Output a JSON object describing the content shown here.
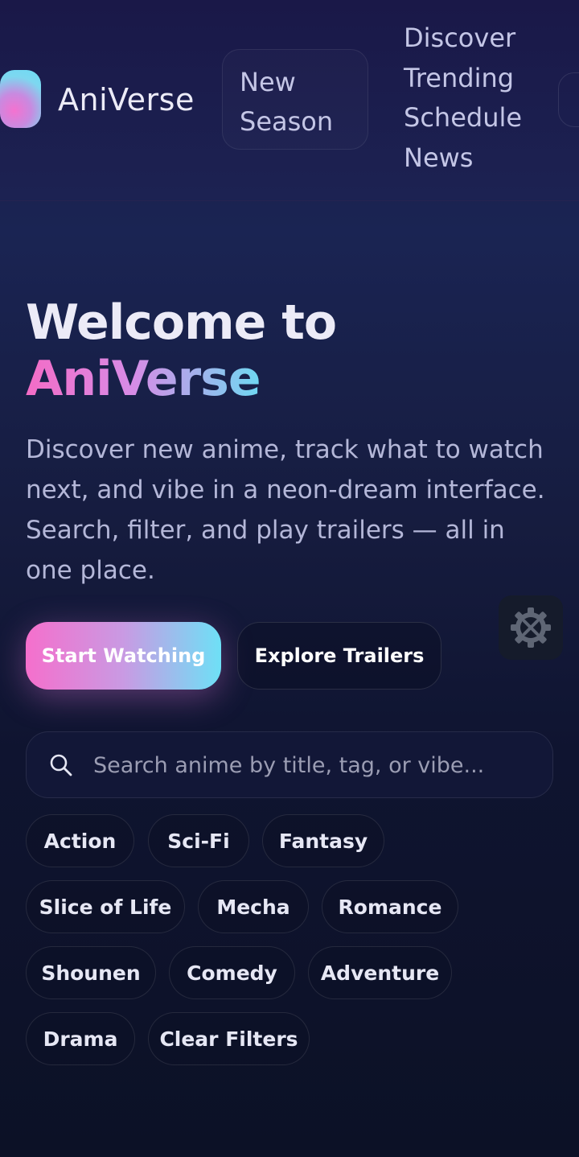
{
  "brand": {
    "name": "AniVerse"
  },
  "nav": {
    "new_season": "New Season",
    "links": [
      "Discover",
      "Trending",
      "Schedule",
      "News"
    ]
  },
  "hero": {
    "title_line1": "Welcome to",
    "title_line2": "AniVerse",
    "description": "Discover new anime, track what to watch next, and vibe in a neon-dream interface. Search, filter, and play trailers — all in one place.",
    "primary_cta": "Start Watching",
    "secondary_cta": "Explore Trailers"
  },
  "search": {
    "placeholder": "Search anime by title, tag, or vibe...",
    "value": ""
  },
  "genres": [
    "Action",
    "Sci-Fi",
    "Fantasy",
    "Slice of Life",
    "Mecha",
    "Romance",
    "Shounen",
    "Comedy",
    "Adventure",
    "Drama",
    "Clear Filters"
  ],
  "icons": {
    "search": "search-icon",
    "settings": "gear-wrench-icon"
  },
  "colors": {
    "accent_pink": "#f56fcc",
    "accent_cyan": "#6ee0f6",
    "background": "#0f1430"
  }
}
